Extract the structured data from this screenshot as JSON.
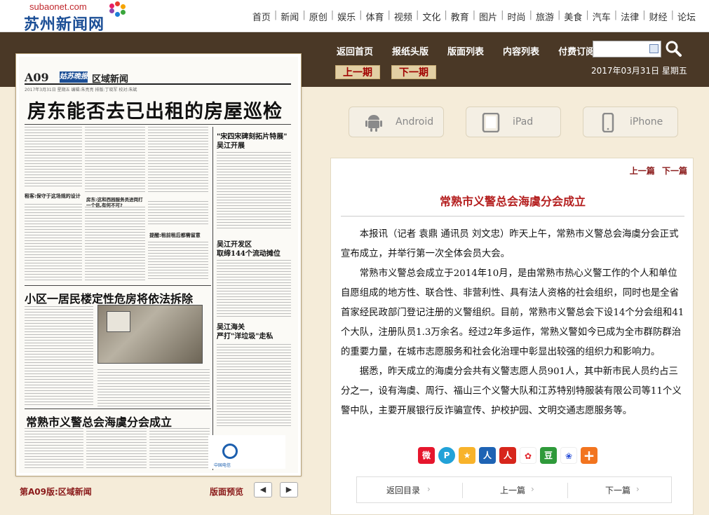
{
  "site": {
    "domain": "subaonet.com",
    "name": "苏州新闻网"
  },
  "topnav": [
    "首页",
    "新闻",
    "原创",
    "娱乐",
    "体育",
    "视频",
    "文化",
    "教育",
    "图片",
    "时尚",
    "旅游",
    "美食",
    "汽车",
    "法律",
    "财经",
    "论坛"
  ],
  "menu": [
    "返回首页",
    "报纸头版",
    "版面列表",
    "内容列表",
    "付费订阅"
  ],
  "search": {
    "value": "",
    "placeholder": ""
  },
  "pager": {
    "prev": "上一期",
    "next": "下一期"
  },
  "date": "2017年03月31日  星期五",
  "paper": {
    "page_no": "A09",
    "brand": "姑苏晚报",
    "section": "区域新闻",
    "header_line": "2017年3月31日  星期五  编辑:朱亮亮  排版:丁晓军  校对:朱斌",
    "headline_main": "房东能否去已出租的房屋巡检",
    "headline_2": "小区一居民楼定性危房将依法拆除",
    "headline_3": "常熟市义警总会海虞分会成立",
    "side_1_line1": "\"宋四宋碑刻拓片特展\"",
    "side_1_line2": "吴江开展",
    "side_2_line1": "吴江开发区",
    "side_2_line2": "取缔144个流动摊位",
    "side_3_line1": "吴江海关",
    "side_3_line2": "严打\"洋垃圾\"走私",
    "sub_1": "租客:保守于这场规的设计",
    "sub_2": "房东:这和西园服务员进岗打一个信,有何不可?",
    "sub_3": "提醒:租前租后都需留意",
    "ad_name": "中国电信"
  },
  "page_label": "第A09版:区域新闻",
  "preview_label": "版面预览",
  "apps": [
    "Android",
    "iPad",
    "iPhone"
  ],
  "article": {
    "nav_prev": "上一篇",
    "nav_next": "下一篇",
    "title": "常熟市义警总会海虞分会成立",
    "paragraphs": [
      "本报讯（记者  袁鼎  通讯员  刘文忠）昨天上午，常熟市义警总会海虞分会正式宣布成立，并举行第一次全体会员大会。",
      "常熟市义警总会成立于2014年10月，是由常熟市热心义警工作的个人和单位自愿组成的地方性、联合性、非营利性、具有法人资格的社会组织，同时也是全省首家经民政部门登记注册的义警组织。目前，常熟市义警总会下设14个分会组和41个大队，注册队员1.3万余名。经过2年多运作，常熟义警如今已成为全市群防群治的重要力量，在城市志愿服务和社会化治理中彰显出较强的组织力和影响力。",
      "据悉，昨天成立的海虞分会共有义警志愿人员901人，其中新市民人员约占三分之一，设有海虞、周行、福山三个义警大队和江苏特别特服装有限公司等11个义警中队，主要开展银行反诈骗宣传、护校护园、文明交通志愿服务等。"
    ],
    "footer": {
      "back": "返回目录",
      "prev": "上一篇",
      "next": "下一篇"
    }
  },
  "share_icons": [
    "weibo-icon",
    "tencent-weibo-icon",
    "qzone-icon",
    "renren-icon",
    "kaixin-icon",
    "sohu-icon",
    "douban-icon",
    "baidu-icon",
    "more-icon"
  ],
  "colors": {
    "band": "#4a3826",
    "accent_red": "#b41e1e",
    "link_red": "#8a1a1a",
    "logo_blue": "#1c4f96"
  }
}
